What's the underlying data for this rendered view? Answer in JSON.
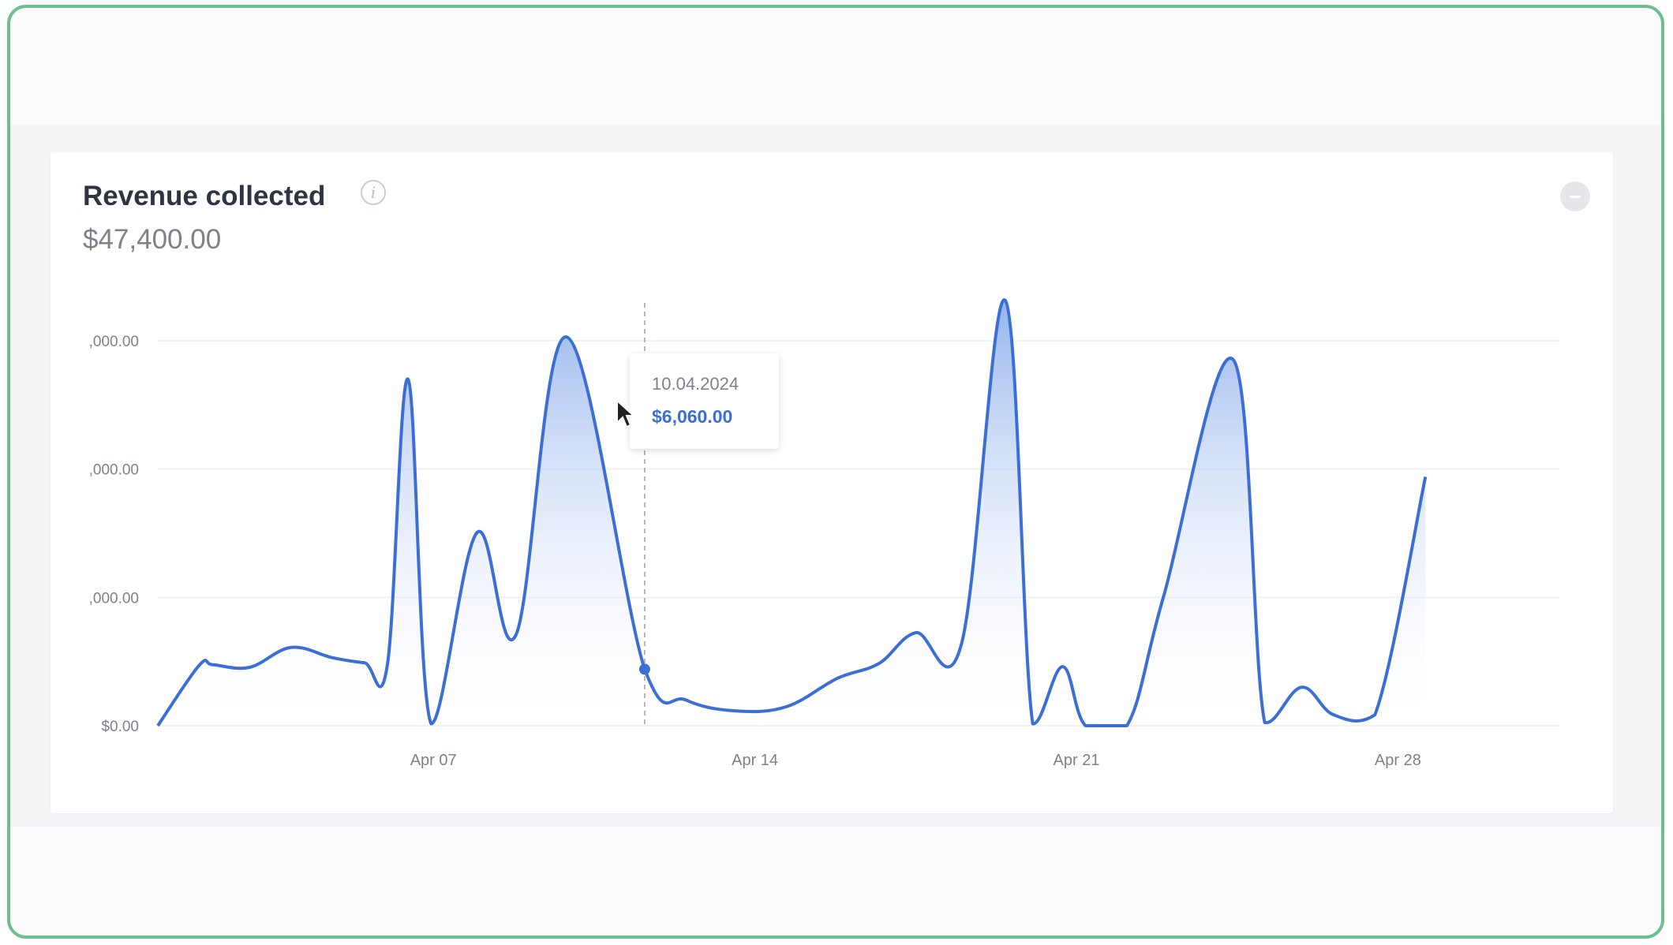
{
  "card": {
    "title": "Revenue collected",
    "total": "$47,400.00",
    "info_icon": "info-icon",
    "collapse_icon": "minus-circle-icon"
  },
  "tooltip": {
    "date": "10.04.2024",
    "value": "$6,060.00"
  },
  "colors": {
    "line": "#3b6fd6",
    "fill_top": "#8fb0ec",
    "grid": "#eceef1",
    "tick_label": "#7d818c",
    "frame": "#6cc08f"
  },
  "chart_data": {
    "type": "area",
    "y_tick_labels": [
      "$0.00",
      ",000.00",
      ",000.00",
      ",000.00"
    ],
    "y_tick_values": [
      0,
      2000,
      4000,
      6000
    ],
    "x_tick_labels": [
      "Apr 07",
      "Apr 14",
      "Apr 21",
      "Apr 28"
    ],
    "x_tick_values": [
      7,
      14,
      21,
      28
    ],
    "ylim": [
      0,
      6000
    ],
    "xlim": [
      1,
      31
    ],
    "grid": true,
    "hover": {
      "x": 11,
      "y": 6060
    },
    "series": [
      {
        "points": [
          [
            1,
            0
          ],
          [
            1.9,
            940
          ],
          [
            2.2,
            950
          ],
          [
            3.0,
            910
          ],
          [
            3.9,
            1220
          ],
          [
            4.8,
            1060
          ],
          [
            5.5,
            980
          ],
          [
            6,
            960
          ],
          [
            6.45,
            5400
          ],
          [
            6.95,
            30
          ],
          [
            7.95,
            3010
          ],
          [
            8.8,
            1420
          ],
          [
            9.9,
            6060
          ],
          [
            11.6,
            880
          ],
          [
            12.5,
            400
          ],
          [
            13.6,
            230
          ],
          [
            14.7,
            300
          ],
          [
            15.8,
            740
          ],
          [
            16.7,
            970
          ],
          [
            17.5,
            1450
          ],
          [
            18.5,
            1280
          ],
          [
            19.45,
            6630
          ],
          [
            20.05,
            30
          ],
          [
            20.7,
            920
          ],
          [
            21.2,
            0
          ],
          [
            22.1,
            0
          ],
          [
            22.9,
            2020
          ],
          [
            24.42,
            5700
          ],
          [
            25.1,
            50
          ],
          [
            25.9,
            600
          ],
          [
            26.6,
            170
          ],
          [
            27.5,
            170
          ],
          [
            28.6,
            3880
          ]
        ]
      }
    ]
  }
}
